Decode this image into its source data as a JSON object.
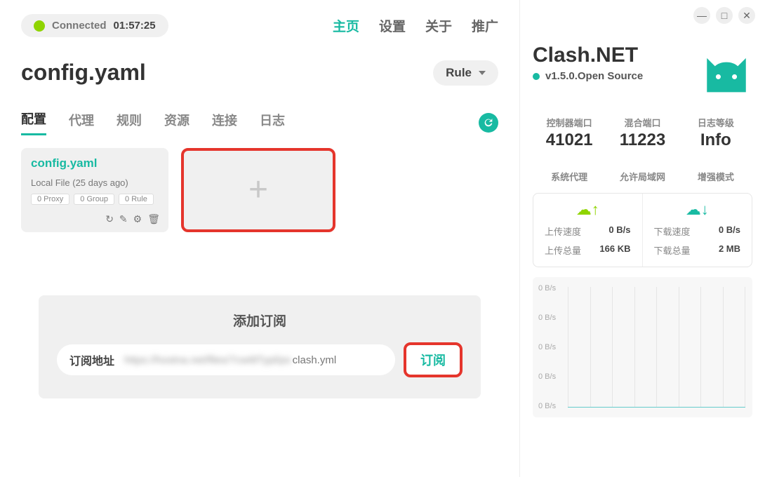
{
  "status": {
    "label": "Connected",
    "time": "01:57:25"
  },
  "nav": {
    "items": [
      "主页",
      "设置",
      "关于",
      "推广"
    ],
    "active": 0
  },
  "page_title": "config.yaml",
  "mode": {
    "label": "Rule"
  },
  "subtabs": {
    "items": [
      "配置",
      "代理",
      "规则",
      "资源",
      "连接",
      "日志"
    ],
    "active": 0
  },
  "config_card": {
    "title": "config.yaml",
    "subtitle": "Local File (25 days ago)",
    "badges": [
      "0 Proxy",
      "0 Group",
      "0 Rule"
    ]
  },
  "subscribe": {
    "heading": "添加订阅",
    "label": "订阅地址",
    "value_blurred": "https://hostna.net/files/7cwI8Typl/po",
    "value_tail": "clash.yml",
    "button": "订阅"
  },
  "brand": {
    "name": "Clash.NET",
    "version": "v1.5.0.Open Source"
  },
  "info": {
    "controller_port": {
      "label": "控制器端口",
      "value": "41021"
    },
    "mixed_port": {
      "label": "混合端口",
      "value": "11223"
    },
    "log_level": {
      "label": "日志等级",
      "value": "Info"
    }
  },
  "switches": [
    "系统代理",
    "允许局域网",
    "增强模式"
  ],
  "speed": {
    "up": {
      "rate_label": "上传速度",
      "rate": "0 B/s",
      "total_label": "上传总量",
      "total": "166 KB"
    },
    "down": {
      "rate_label": "下载速度",
      "rate": "0 B/s",
      "total_label": "下载总量",
      "total": "2 MB"
    }
  },
  "chart_data": {
    "type": "line",
    "ylabel": "B/s",
    "ylim": [
      0,
      0
    ],
    "y_ticks": [
      "0 B/s",
      "0 B/s",
      "0 B/s",
      "0 B/s",
      "0 B/s"
    ],
    "series": [
      {
        "name": "upload",
        "values": [
          0,
          0,
          0,
          0,
          0,
          0,
          0,
          0,
          0,
          0
        ]
      },
      {
        "name": "download",
        "values": [
          0,
          0,
          0,
          0,
          0,
          0,
          0,
          0,
          0,
          0
        ]
      }
    ]
  }
}
